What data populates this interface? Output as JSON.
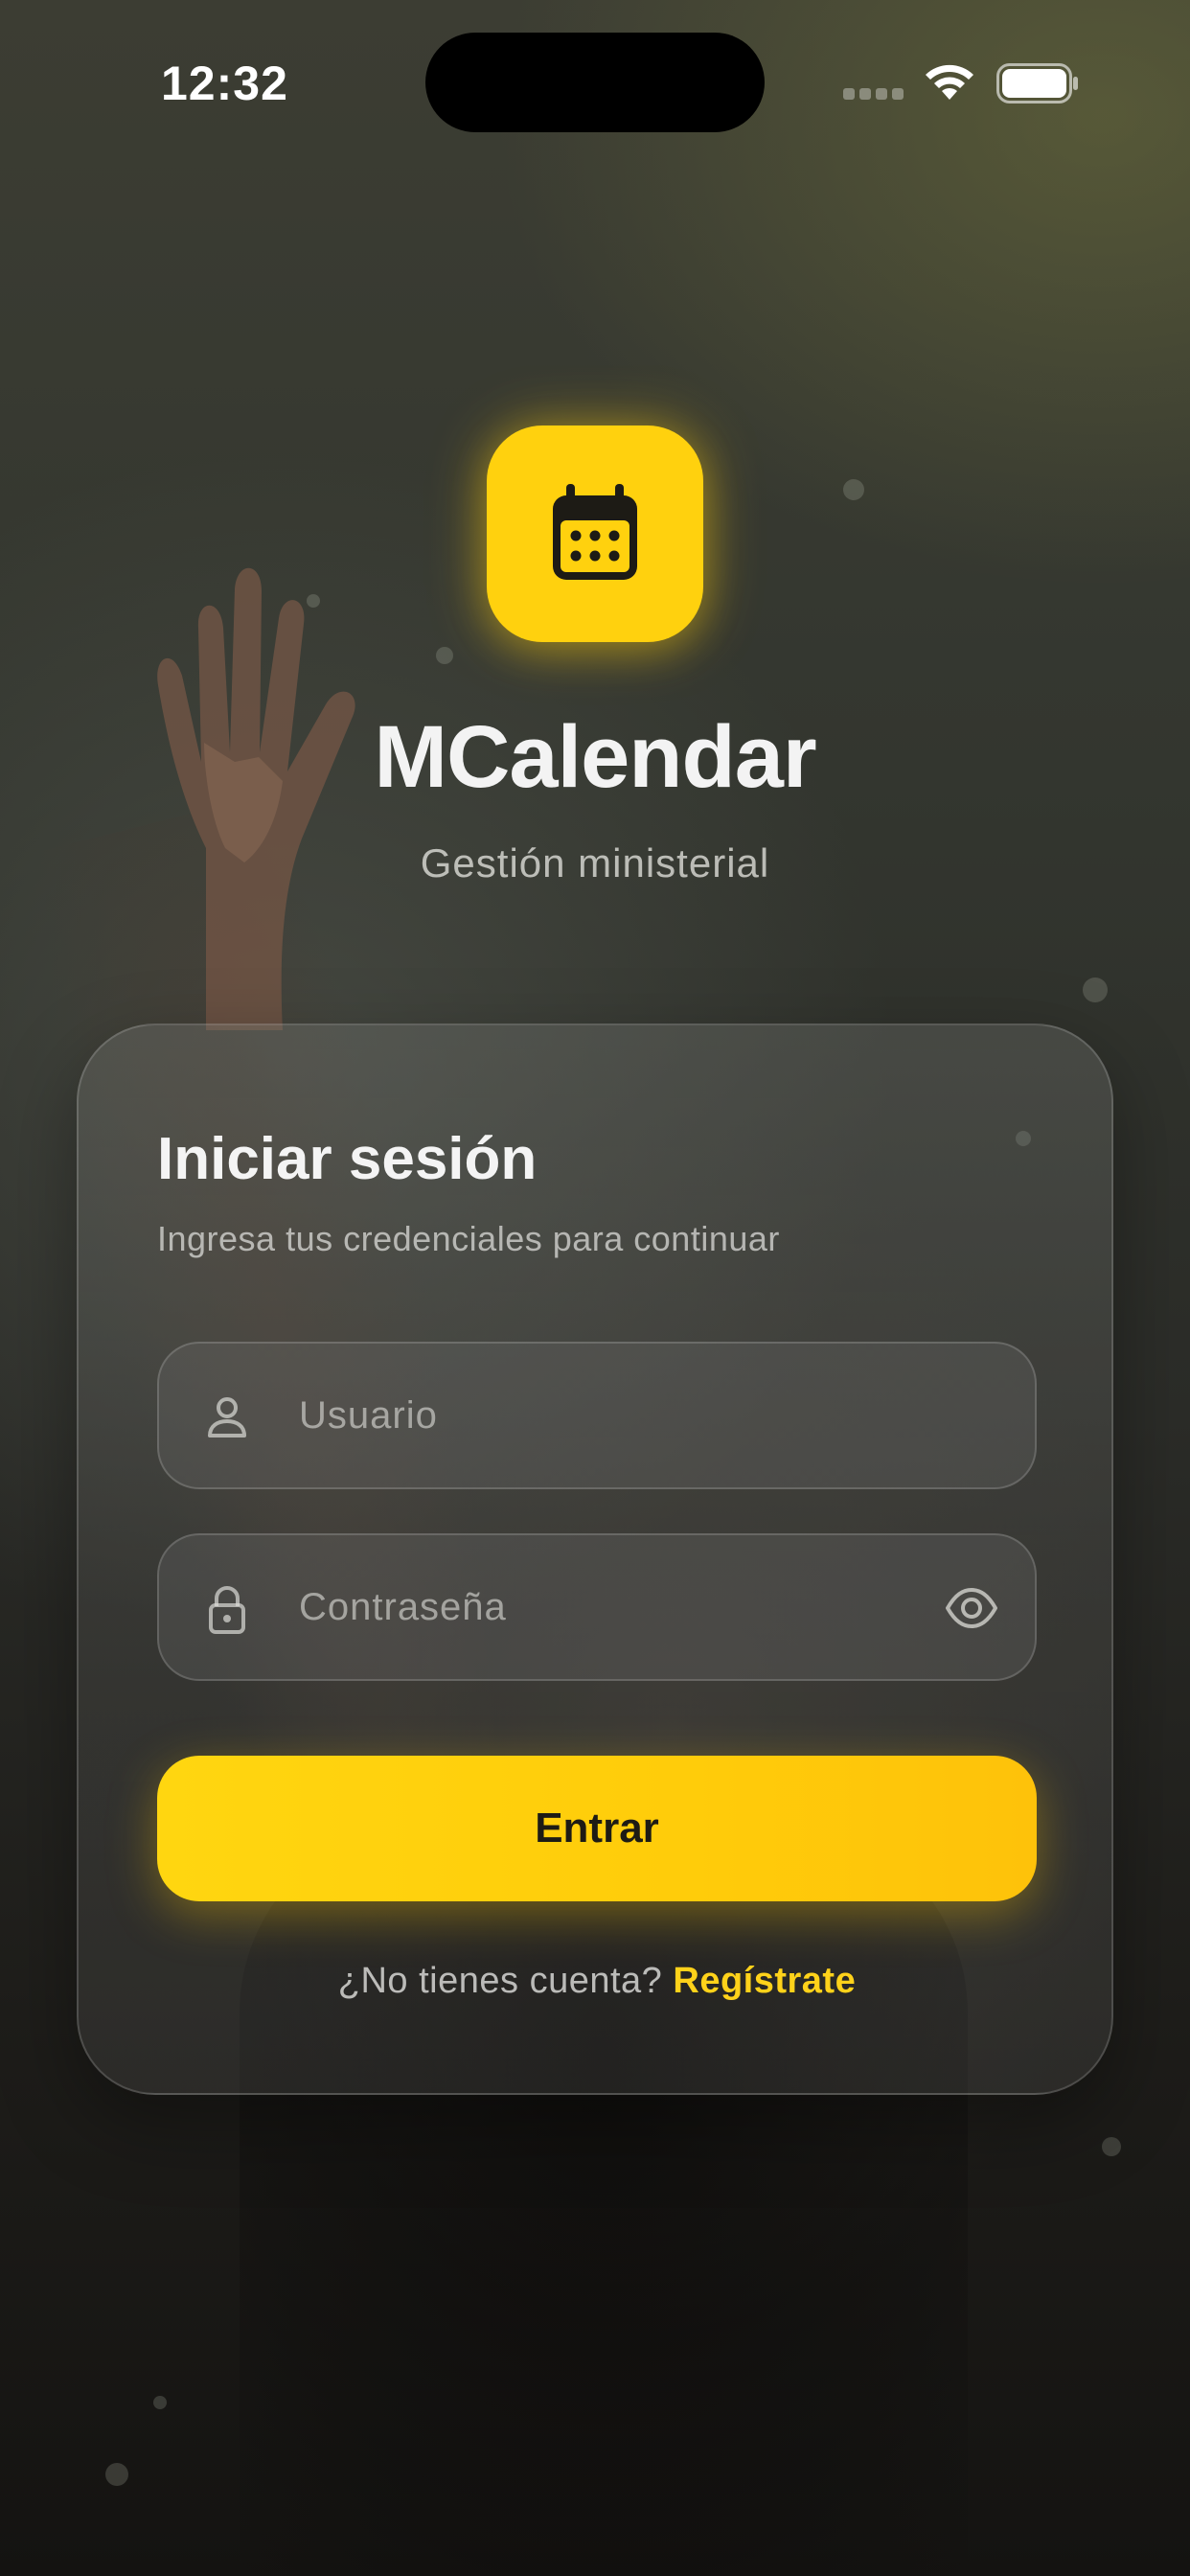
{
  "status_bar": {
    "time": "12:32"
  },
  "app": {
    "icon": "calendar-icon",
    "title": "MCalendar",
    "subtitle": "Gestión ministerial"
  },
  "login": {
    "title": "Iniciar sesión",
    "subtitle": "Ingresa tus credenciales para continuar",
    "username": {
      "icon": "user-icon",
      "placeholder": "Usuario",
      "value": ""
    },
    "password": {
      "icon": "lock-icon",
      "toggle_icon": "eye-icon",
      "placeholder": "Contraseña",
      "value": ""
    },
    "submit_label": "Entrar",
    "signup_prompt": "¿No tienes cuenta?",
    "signup_link": "Regístrate"
  },
  "colors": {
    "accent": "#FFD10E",
    "button_text": "#1D1B15",
    "background": "#2B2C28"
  }
}
